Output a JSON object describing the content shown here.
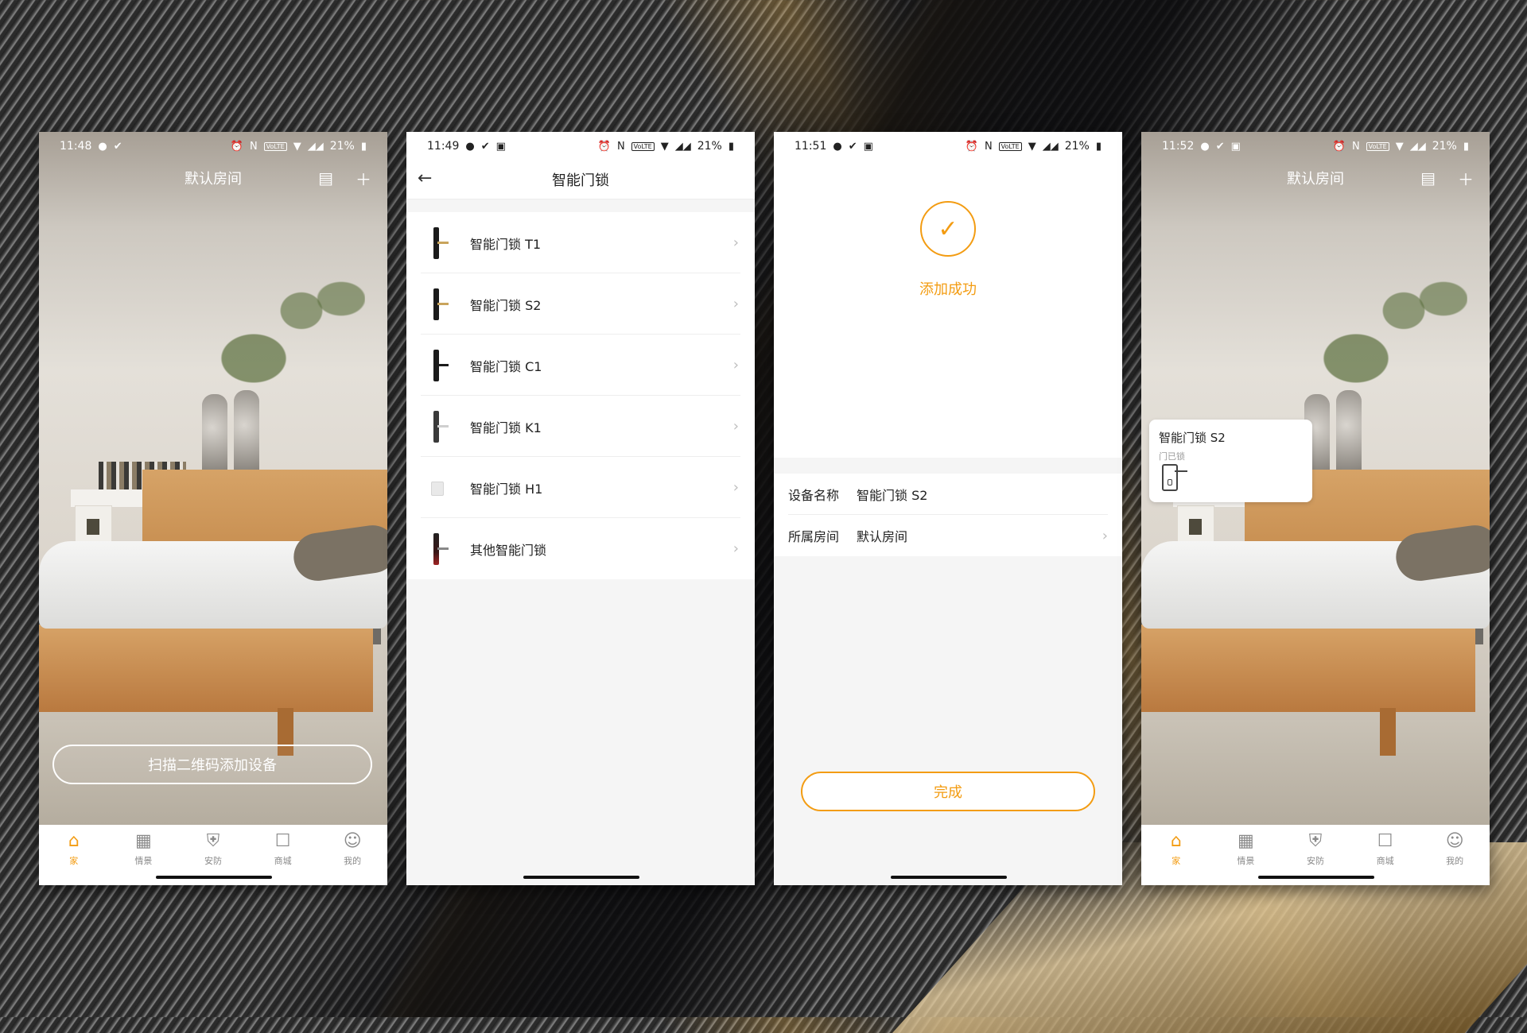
{
  "phones": [
    {
      "status_time": "11:48",
      "battery": "21%",
      "room_title": "默认房间",
      "scan_button": "扫描二维码添加设备",
      "tabs": [
        {
          "label": "家",
          "icon": "home-icon",
          "active": true
        },
        {
          "label": "情景",
          "icon": "scene-icon",
          "active": false
        },
        {
          "label": "安防",
          "icon": "shield-icon",
          "active": false
        },
        {
          "label": "商城",
          "icon": "shop-icon",
          "active": false
        },
        {
          "label": "我的",
          "icon": "user-icon",
          "active": false
        }
      ]
    },
    {
      "status_time": "11:49",
      "battery": "21%",
      "title": "智能门锁",
      "items": [
        {
          "label": "智能门锁 T1"
        },
        {
          "label": "智能门锁 S2"
        },
        {
          "label": "智能门锁 C1"
        },
        {
          "label": "智能门锁 K1"
        },
        {
          "label": "智能门锁 H1"
        },
        {
          "label": "其他智能门锁"
        }
      ]
    },
    {
      "status_time": "11:51",
      "battery": "21%",
      "success_text": "添加成功",
      "device_name_label": "设备名称",
      "device_name_value": "智能门锁 S2",
      "room_label": "所属房间",
      "room_value": "默认房间",
      "done_button": "完成"
    },
    {
      "status_time": "11:52",
      "battery": "21%",
      "room_title": "默认房间",
      "device_card_name": "智能门锁 S2",
      "device_card_status": "门已锁",
      "tabs": [
        {
          "label": "家",
          "icon": "home-icon",
          "active": true
        },
        {
          "label": "情景",
          "icon": "scene-icon",
          "active": false
        },
        {
          "label": "安防",
          "icon": "shield-icon",
          "active": false
        },
        {
          "label": "商城",
          "icon": "shop-icon",
          "active": false
        },
        {
          "label": "我的",
          "icon": "user-icon",
          "active": false
        }
      ]
    }
  ],
  "accent_color": "#f39c12"
}
